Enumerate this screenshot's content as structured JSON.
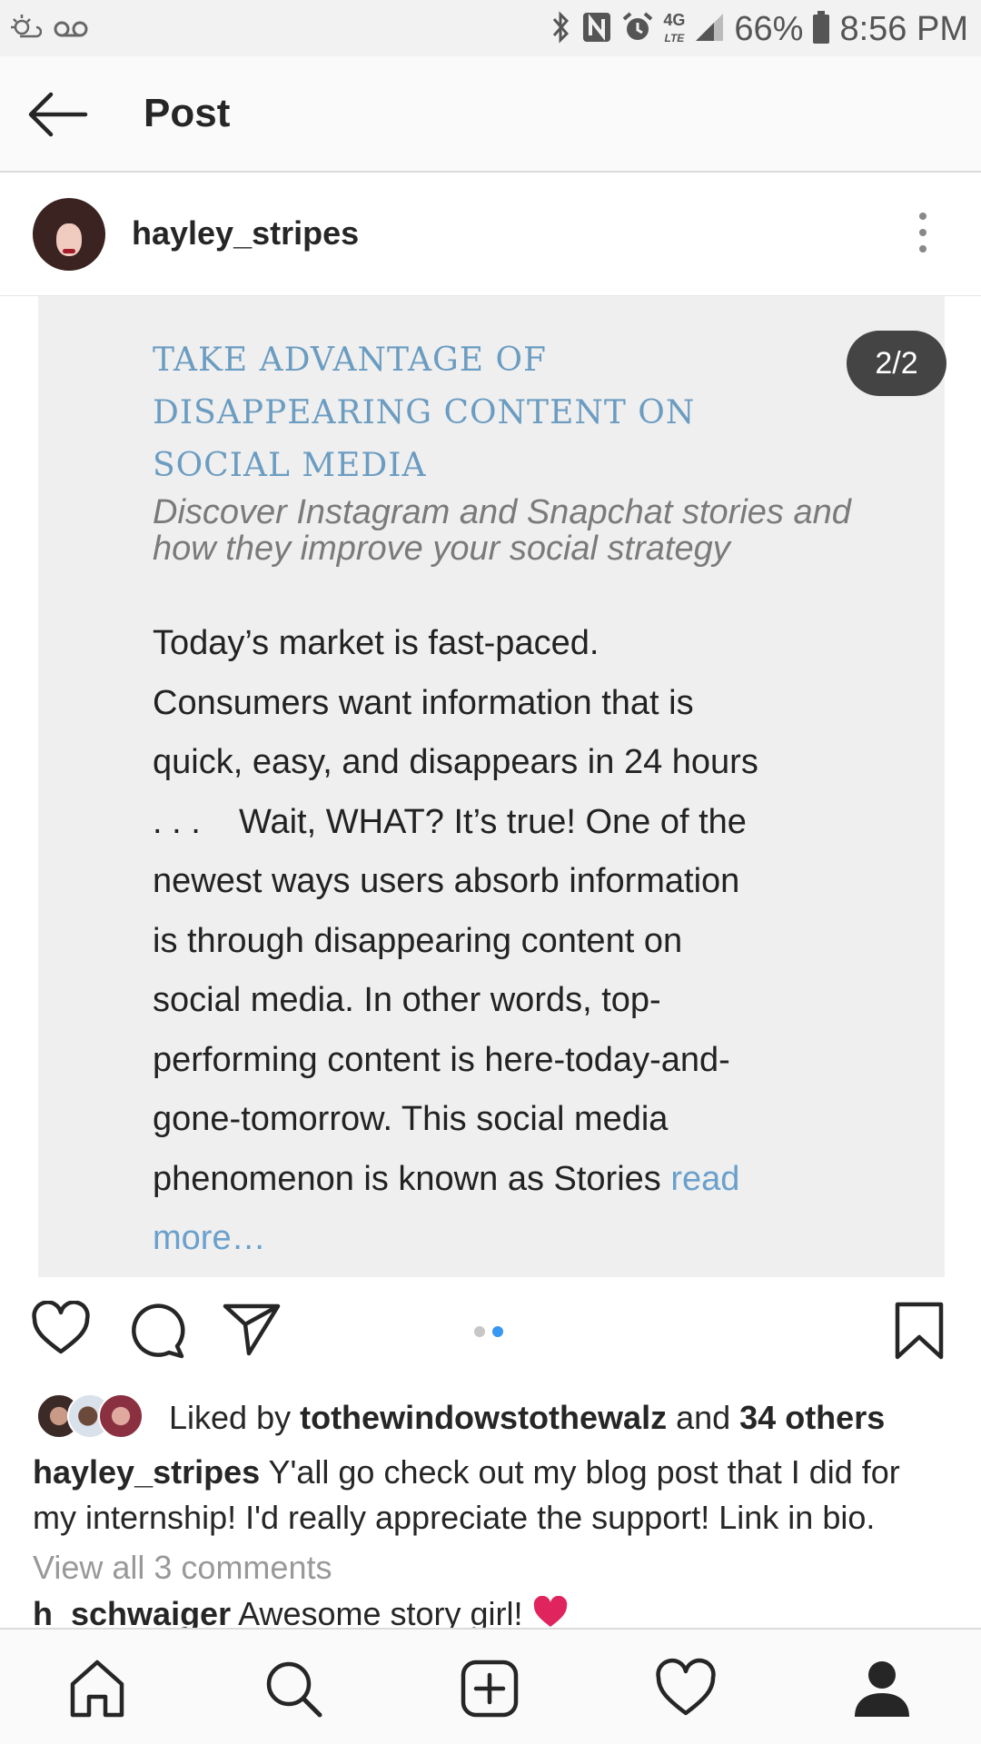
{
  "status_bar": {
    "battery": "66%",
    "time": "8:56 PM",
    "network": "4G LTE",
    "left_icons": [
      "weather-icon",
      "voicemail-icon"
    ],
    "right_icons": [
      "bluetooth-icon",
      "nfc-icon",
      "alarm-icon",
      "signal-icon",
      "battery-icon"
    ]
  },
  "app_bar": {
    "back_icon": "arrow-left-icon",
    "title": "Post"
  },
  "post": {
    "username": "hayley_stripes",
    "menu_icon": "more-vertical-icon",
    "carousel_counter": "2/2",
    "slide": {
      "title_lines": [
        "TAKE ADVANTAGE OF",
        "DISAPPEARING CONTENT ON",
        "SOCIAL MEDIA"
      ],
      "subtitle_lines": [
        "Discover Instagram and Snapchat stories and",
        "how they improve your social strategy"
      ],
      "body_lines": [
        "Today’s market is fast-paced.",
        "Consumers want information that is",
        "quick, easy, and disappears in 24 hours",
        ". . .    Wait, WHAT? It’s true! One of the",
        "newest ways users absorb information",
        "is through disappearing content on",
        "social media. In other words, top-",
        "performing content is here-today-and-",
        "gone-tomorrow. This social media"
      ],
      "body_last_line": "phenomenon is known as Stories ",
      "read_more_1": "read",
      "read_more_2": "more…"
    },
    "actions": {
      "like_icon": "heart-outline-icon",
      "comment_icon": "comment-icon",
      "share_icon": "send-icon",
      "save_icon": "bookmark-icon",
      "carousel_dots": 2,
      "active_dot": 2
    },
    "likes": {
      "prefix": "Liked by ",
      "liked_by_user": "tothewindowstothewalz",
      "middle": " and ",
      "others": "34 others"
    },
    "caption": {
      "username": "hayley_stripes",
      "text": " Y'all go check out my blog post that I did for my internship! I'd really appreciate the support! Link in bio."
    },
    "view_comments": "View all 3 comments",
    "comment": {
      "username": "h_schwaiger",
      "text": " Awesome story girl! "
    }
  },
  "bottom_nav": {
    "items": [
      "home-icon",
      "search-icon",
      "add-post-icon",
      "activity-heart-icon",
      "profile-icon"
    ]
  },
  "colors": {
    "slide_title": "#6b9cc1",
    "read_more": "#6aa0cc",
    "active_dot": "#3897f0",
    "heart_emoji": "#e0245e"
  }
}
